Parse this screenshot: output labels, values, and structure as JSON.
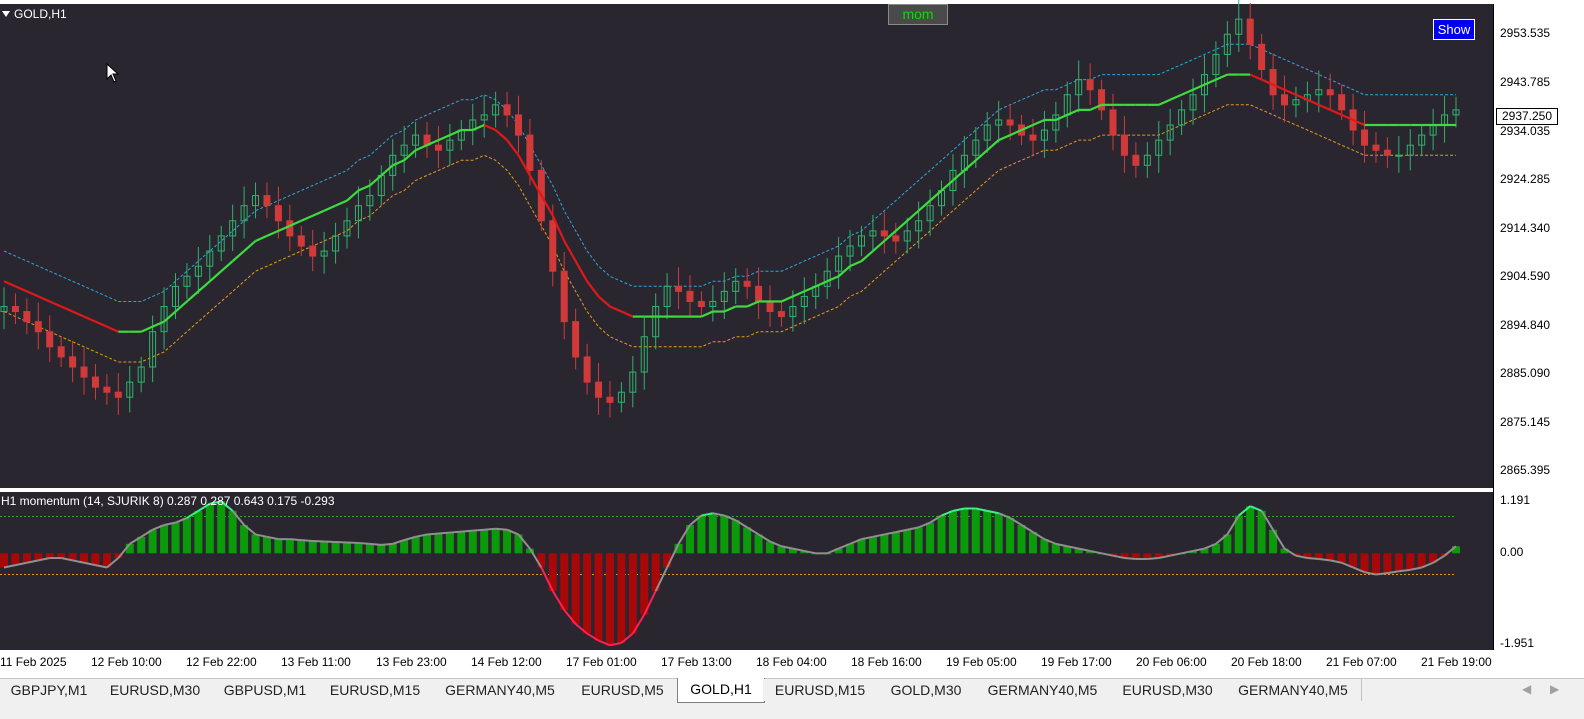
{
  "window": {
    "symbol": "GOLD,H1"
  },
  "buttons": {
    "mom": "mom",
    "show": "Show"
  },
  "indicator": {
    "label": "H1 momentum (14,  SJURIK 8) 0.287 0.287 0.643 0.175 -0.293",
    "ticks": [
      "1.191",
      "0.00",
      "-1.951"
    ]
  },
  "price_axis": {
    "ticks": [
      "2953.535",
      "2943.785",
      "2934.035",
      "2924.285",
      "2914.340",
      "2904.590",
      "2894.840",
      "2885.090",
      "2875.145",
      "2865.395"
    ],
    "current": "2937.250"
  },
  "time_axis": {
    "ticks": [
      "11 Feb 2025",
      "12 Feb 10:00",
      "12 Feb 22:00",
      "13 Feb 11:00",
      "13 Feb 23:00",
      "14 Feb 12:00",
      "17 Feb 01:00",
      "17 Feb 13:00",
      "18 Feb 04:00",
      "18 Feb 16:00",
      "19 Feb 05:00",
      "19 Feb 17:00",
      "20 Feb 06:00",
      "20 Feb 18:00",
      "21 Feb 07:00",
      "21 Feb 19:00"
    ]
  },
  "tabs": [
    {
      "label": "GBPJPY,M1",
      "active": false
    },
    {
      "label": "EURUSD,M30",
      "active": false
    },
    {
      "label": "GBPUSD,M1",
      "active": false
    },
    {
      "label": "EURUSD,M15",
      "active": false
    },
    {
      "label": "GERMANY40,M5",
      "active": false
    },
    {
      "label": "EURUSD,M5",
      "active": false
    },
    {
      "label": "GOLD,H1",
      "active": true
    },
    {
      "label": "EURUSD,M15",
      "active": false
    },
    {
      "label": "GOLD,M30",
      "active": false
    },
    {
      "label": "GERMANY40,M5",
      "active": false
    },
    {
      "label": "EURUSD,M30",
      "active": false
    },
    {
      "label": "GERMANY40,M5",
      "active": false
    }
  ],
  "colors": {
    "chart_bg": "#2a2630",
    "bull_candle": "#2fb36b",
    "bear_candle": "#d23a3a",
    "ma_up": "#3ddc3d",
    "ma_down": "#e01818",
    "band_upper": "#2aa8d8",
    "band_lower": "#e89a18",
    "hist_pos": "#0a9a0a",
    "hist_neg": "#a80808"
  },
  "chart_data": {
    "type": "candlestick",
    "price_series": [
      2898,
      2897,
      2895,
      2893,
      2890,
      2888,
      2886,
      2884,
      2882,
      2881,
      2880,
      2883,
      2886,
      2893,
      2898,
      2902,
      2904,
      2906,
      2909,
      2912,
      2915,
      2918,
      2920,
      2918,
      2915,
      2912,
      2910,
      2908,
      2909,
      2912,
      2915,
      2918,
      2920,
      2924,
      2928,
      2930,
      2932,
      2930,
      2929,
      2931,
      2933,
      2935,
      2936,
      2938,
      2936,
      2932,
      2925,
      2915,
      2905,
      2895,
      2888,
      2883,
      2880,
      2879,
      2881,
      2885,
      2892,
      2898,
      2902,
      2901,
      2899,
      2898,
      2899,
      2901,
      2903,
      2902,
      2899,
      2897,
      2896,
      2898,
      2900,
      2902,
      2905,
      2908,
      2910,
      2912,
      2913,
      2912,
      2911,
      2913,
      2915,
      2918,
      2921,
      2925,
      2928,
      2931,
      2934,
      2935,
      2934,
      2932,
      2931,
      2933,
      2936,
      2940,
      2943,
      2941,
      2937,
      2932,
      2928,
      2926,
      2928,
      2931,
      2934,
      2937,
      2940,
      2944,
      2948,
      2952,
      2955,
      2950,
      2945,
      2940,
      2938,
      2939,
      2940,
      2941,
      2940,
      2937,
      2933,
      2930,
      2929,
      2928,
      2928,
      2930,
      2932,
      2934,
      2936,
      2937
    ],
    "ma_series": [
      2903,
      2902,
      2901,
      2900,
      2899,
      2898,
      2897,
      2896,
      2895,
      2894,
      2893,
      2893,
      2893,
      2894,
      2895,
      2897,
      2899,
      2901,
      2903,
      2905,
      2907,
      2909,
      2911,
      2912,
      2913,
      2914,
      2915,
      2916,
      2917,
      2918,
      2919,
      2921,
      2922,
      2924,
      2926,
      2927,
      2929,
      2930,
      2931,
      2932,
      2933,
      2933,
      2934,
      2933,
      2931,
      2928,
      2924,
      2920,
      2916,
      2911,
      2907,
      2903,
      2900,
      2898,
      2897,
      2896,
      2896,
      2896,
      2896,
      2896,
      2896,
      2896,
      2897,
      2897,
      2898,
      2898,
      2899,
      2899,
      2899,
      2900,
      2901,
      2902,
      2903,
      2904,
      2906,
      2907,
      2909,
      2911,
      2913,
      2915,
      2917,
      2919,
      2921,
      2923,
      2925,
      2927,
      2929,
      2931,
      2932,
      2933,
      2934,
      2935,
      2935,
      2936,
      2937,
      2937,
      2938,
      2938,
      2938,
      2938,
      2938,
      2938,
      2939,
      2940,
      2941,
      2942,
      2943,
      2944,
      2944,
      2944,
      2943,
      2942,
      2941,
      2940,
      2939,
      2938,
      2937,
      2936,
      2935,
      2934,
      2934,
      2934,
      2934,
      2934,
      2934,
      2934,
      2934,
      2934
    ],
    "momentum_series": [
      -0.3,
      -0.25,
      -0.2,
      -0.15,
      -0.1,
      -0.1,
      -0.15,
      -0.2,
      -0.25,
      -0.3,
      -0.1,
      0.2,
      0.35,
      0.5,
      0.6,
      0.65,
      0.75,
      0.9,
      1.05,
      1.1,
      0.9,
      0.6,
      0.4,
      0.35,
      0.3,
      0.3,
      0.28,
      0.26,
      0.25,
      0.24,
      0.23,
      0.22,
      0.2,
      0.18,
      0.2,
      0.28,
      0.35,
      0.4,
      0.42,
      0.44,
      0.46,
      0.48,
      0.5,
      0.52,
      0.5,
      0.4,
      0.1,
      -0.3,
      -0.8,
      -1.2,
      -1.5,
      -1.7,
      -1.85,
      -1.95,
      -1.9,
      -1.7,
      -1.3,
      -0.8,
      -0.3,
      0.2,
      0.6,
      0.8,
      0.85,
      0.8,
      0.7,
      0.55,
      0.4,
      0.25,
      0.15,
      0.1,
      0.05,
      0.0,
      0.0,
      0.1,
      0.2,
      0.3,
      0.35,
      0.4,
      0.45,
      0.5,
      0.55,
      0.65,
      0.8,
      0.9,
      0.95,
      0.95,
      0.9,
      0.85,
      0.75,
      0.6,
      0.45,
      0.3,
      0.2,
      0.15,
      0.1,
      0.05,
      0.0,
      -0.05,
      -0.1,
      -0.12,
      -0.12,
      -0.1,
      -0.05,
      0.0,
      0.05,
      0.1,
      0.2,
      0.4,
      0.8,
      1.0,
      0.9,
      0.5,
      0.1,
      -0.05,
      -0.1,
      -0.12,
      -0.15,
      -0.2,
      -0.3,
      -0.4,
      -0.45,
      -0.42,
      -0.38,
      -0.35,
      -0.3,
      -0.2,
      -0.05,
      0.15,
      0.25
    ]
  }
}
